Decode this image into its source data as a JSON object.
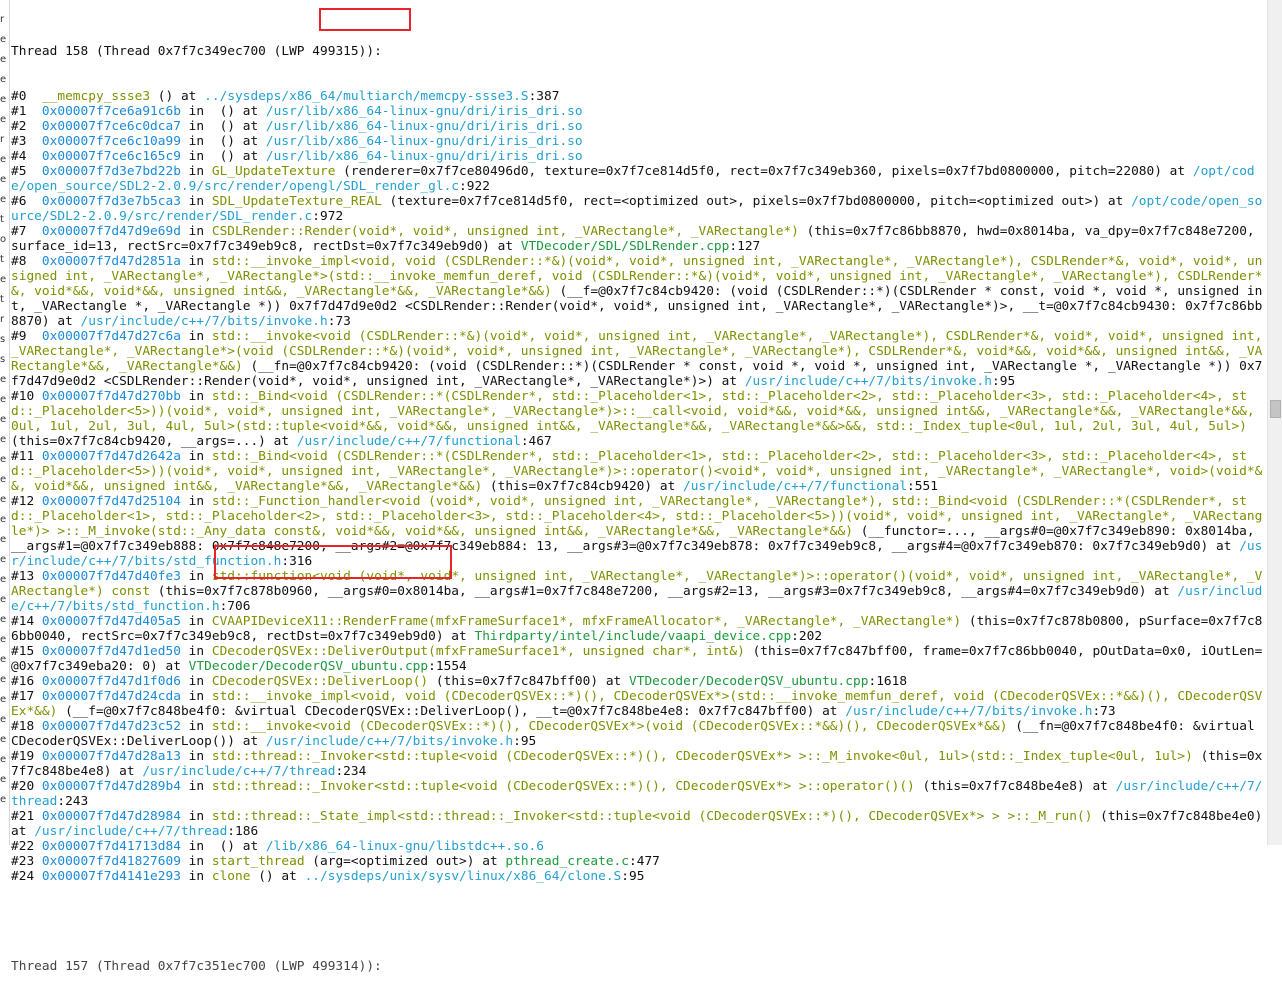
{
  "left_strip": [
    "r",
    "e",
    "e",
    "e",
    "e",
    "e",
    "r",
    "e",
    "e",
    "e",
    "t",
    "o",
    "t",
    "e",
    "t",
    "r",
    "s",
    "s",
    "e",
    "e",
    "e",
    "e",
    "e",
    "e",
    "e",
    "e",
    "e",
    "e",
    "e",
    "e",
    "e",
    "e",
    "e",
    "e",
    "e",
    "e",
    "e",
    "e",
    "e",
    "e"
  ],
  "header": {
    "prefix": "Thread 158 (Thread 0x7f7c349ec700 (LWP ",
    "lwp": "499315",
    "suffix": ")):"
  },
  "frames": [
    {
      "num": "#0  ",
      "segments": [
        {
          "t": "fn",
          "v": "__memcpy_ssse3"
        },
        {
          "t": "plain",
          "v": " () at "
        },
        {
          "t": "path",
          "v": "../sysdeps/x86_64/multiarch/memcpy-ssse3.S"
        },
        {
          "t": "plain",
          "v": ":387"
        }
      ]
    },
    {
      "num": "#1  ",
      "segments": [
        {
          "t": "addr",
          "v": "0x00007f7ce6a91c6b"
        },
        {
          "t": "plain",
          "v": " in  () at "
        },
        {
          "t": "path",
          "v": "/usr/lib/x86_64-linux-gnu/dri/iris_dri.so"
        }
      ]
    },
    {
      "num": "#2  ",
      "segments": [
        {
          "t": "addr",
          "v": "0x00007f7ce6c0dca7"
        },
        {
          "t": "plain",
          "v": " in  () at "
        },
        {
          "t": "path",
          "v": "/usr/lib/x86_64-linux-gnu/dri/iris_dri.so"
        }
      ]
    },
    {
      "num": "#3  ",
      "segments": [
        {
          "t": "addr",
          "v": "0x00007f7ce6c10a99"
        },
        {
          "t": "plain",
          "v": " in  () at "
        },
        {
          "t": "path",
          "v": "/usr/lib/x86_64-linux-gnu/dri/iris_dri.so"
        }
      ]
    },
    {
      "num": "#4  ",
      "segments": [
        {
          "t": "addr",
          "v": "0x00007f7ce6c165c9"
        },
        {
          "t": "plain",
          "v": " in  () at "
        },
        {
          "t": "path",
          "v": "/usr/lib/x86_64-linux-gnu/dri/iris_dri.so"
        }
      ]
    },
    {
      "num": "#5  ",
      "segments": [
        {
          "t": "addr",
          "v": "0x00007f7d3e7bd22b"
        },
        {
          "t": "plain",
          "v": " in "
        },
        {
          "t": "fn",
          "v": "GL_UpdateTexture"
        },
        {
          "t": "plain",
          "v": " (renderer=0x7f7ce80496d0, texture=0x7f7ce814d5f0, rect=0x7f7c349eb360, pixels=0x7f7bd0800000, pitch=22080) at "
        },
        {
          "t": "path",
          "v": "/opt/code/open_source/SDL2-2.0.9/src/render/opengl/SDL_render_gl.c"
        },
        {
          "t": "plain",
          "v": ":922"
        }
      ]
    },
    {
      "num": "#6  ",
      "segments": [
        {
          "t": "addr",
          "v": "0x00007f7d3e7b5ca3"
        },
        {
          "t": "plain",
          "v": " in "
        },
        {
          "t": "fn",
          "v": "SDL_UpdateTexture_REAL"
        },
        {
          "t": "plain",
          "v": " (texture=0x7f7ce814d5f0, rect=<optimized out>, pixels=0x7f7bd0800000, pitch=<optimized out>) at "
        },
        {
          "t": "path",
          "v": "/opt/code/open_source/SDL2-2.0.9/src/render/SDL_render.c"
        },
        {
          "t": "plain",
          "v": ":972"
        }
      ]
    },
    {
      "num": "#7  ",
      "segments": [
        {
          "t": "addr",
          "v": "0x00007f7d47d9e69d"
        },
        {
          "t": "plain",
          "v": " in "
        },
        {
          "t": "fn",
          "v": "CSDLRender::Render(void*, void*, unsigned int, _VARectangle*, _VARectangle*)"
        },
        {
          "t": "plain",
          "v": " (this=0x7f7c86bb8870, hwd=0x8014ba, va_dpy=0x7f7c848e7200, surface_id=13, rectSrc=0x7f7c349eb9c8, rectDst=0x7f7c349eb9d0) at "
        },
        {
          "t": "file",
          "v": "VTDecoder/SDL/SDLRender.cpp"
        },
        {
          "t": "plain",
          "v": ":127"
        }
      ]
    },
    {
      "num": "#8  ",
      "segments": [
        {
          "t": "addr",
          "v": "0x00007f7d47d2851a"
        },
        {
          "t": "plain",
          "v": " in "
        },
        {
          "t": "fn",
          "v": "std::__invoke_impl<void, void (CSDLRender::*&)(void*, void*, unsigned int, _VARectangle*, _VARectangle*), CSDLRender*&, void*, void*, unsigned int, _VARectangle*, _VARectangle*>(std::__invoke_memfun_deref, void (CSDLRender::*&)(void*, void*, unsigned int, _VARectangle*, _VARectangle*), CSDLRender*&, void*&&, void*&&, unsigned int&&, _VARectangle*&&, _VARectangle*&&)"
        },
        {
          "t": "plain",
          "v": " (__f=@0x7f7c84cb9420: (void (CSDLRender::*)(CSDLRender * const, void *, void *, unsigned int, _VARectangle *, _VARectangle *)) 0x7f7d47d9e0d2 <CSDLRender::Render(void*, void*, unsigned int, _VARectangle*, _VARectangle*)>, __t=@0x7f7c84cb9430: 0x7f7c86bb8870) at "
        },
        {
          "t": "path",
          "v": "/usr/include/c++/7/bits/invoke.h"
        },
        {
          "t": "plain",
          "v": ":73"
        }
      ]
    },
    {
      "num": "#9  ",
      "segments": [
        {
          "t": "addr",
          "v": "0x00007f7d47d27c6a"
        },
        {
          "t": "plain",
          "v": " in "
        },
        {
          "t": "fn",
          "v": "std::__invoke<void (CSDLRender::*&)(void*, void*, unsigned int, _VARectangle*, _VARectangle*), CSDLRender*&, void*, void*, unsigned int, _VARectangle*, _VARectangle*>(void (CSDLRender::*&)(void*, void*, unsigned int, _VARectangle*, _VARectangle*), CSDLRender*&, void*&&, void*&&, unsigned int&&, _VARectangle*&&, _VARectangle*&&)"
        },
        {
          "t": "plain",
          "v": " (__fn=@0x7f7c84cb9420: (void (CSDLRender::*)(CSDLRender * const, void *, void *, unsigned int, _VARectangle *, _VARectangle *)) 0x7f7d47d9e0d2 <CSDLRender::Render(void*, void*, unsigned int, _VARectangle*, _VARectangle*)>) at "
        },
        {
          "t": "path",
          "v": "/usr/include/c++/7/bits/invoke.h"
        },
        {
          "t": "plain",
          "v": ":95"
        }
      ]
    },
    {
      "num": "#10 ",
      "segments": [
        {
          "t": "addr",
          "v": "0x00007f7d47d270bb"
        },
        {
          "t": "plain",
          "v": " in "
        },
        {
          "t": "fn",
          "v": "std::_Bind<void (CSDLRender::*(CSDLRender*, std::_Placeholder<1>, std::_Placeholder<2>, std::_Placeholder<3>, std::_Placeholder<4>, std::_Placeholder<5>))(void*, void*, unsigned int, _VARectangle*, _VARectangle*)>::__call<void, void*&&, void*&&, unsigned int&&, _VARectangle*&&, _VARectangle*&&, 0ul, 1ul, 2ul, 3ul, 4ul, 5ul>(std::tuple<void*&&, void*&&, unsigned int&&, _VARectangle*&&, _VARectangle*&&>&&, std::_Index_tuple<0ul, 1ul, 2ul, 3ul, 4ul, 5ul>)"
        },
        {
          "t": "plain",
          "v": " (this=0x7f7c84cb9420, __args=...) at "
        },
        {
          "t": "path",
          "v": "/usr/include/c++/7/functional"
        },
        {
          "t": "plain",
          "v": ":467"
        }
      ]
    },
    {
      "num": "#11 ",
      "segments": [
        {
          "t": "addr",
          "v": "0x00007f7d47d2642a"
        },
        {
          "t": "plain",
          "v": " in "
        },
        {
          "t": "fn",
          "v": "std::_Bind<void (CSDLRender::*(CSDLRender*, std::_Placeholder<1>, std::_Placeholder<2>, std::_Placeholder<3>, std::_Placeholder<4>, std::_Placeholder<5>))(void*, void*, unsigned int, _VARectangle*, _VARectangle*)>::operator()<void*, void*, unsigned int, _VARectangle*, _VARectangle*, void>(void*&&, void*&&, unsigned int&&, _VARectangle*&&, _VARectangle*&&)"
        },
        {
          "t": "plain",
          "v": " (this=0x7f7c84cb9420) at "
        },
        {
          "t": "path",
          "v": "/usr/include/c++/7/functional"
        },
        {
          "t": "plain",
          "v": ":551"
        }
      ]
    },
    {
      "num": "#12 ",
      "segments": [
        {
          "t": "addr",
          "v": "0x00007f7d47d25104"
        },
        {
          "t": "plain",
          "v": " in "
        },
        {
          "t": "fn",
          "v": "std::_Function_handler<void (void*, void*, unsigned int, _VARectangle*, _VARectangle*), std::_Bind<void (CSDLRender::*(CSDLRender*, std::_Placeholder<1>, std::_Placeholder<2>, std::_Placeholder<3>, std::_Placeholder<4>, std::_Placeholder<5>))(void*, void*, unsigned int, _VARectangle*, _VARectangle*)> >::_M_invoke(std::_Any_data const&, void*&&, void*&&, unsigned int&&, _VARectangle*&&, _VARectangle*&&)"
        },
        {
          "t": "plain",
          "v": " (__functor=..., __args#0=@0x7f7c349eb890: 0x8014ba, __args#1=@0x7f7c349eb888: 0x7f7c848e7200, __args#2=@0x7f7c349eb884: 13, __args#3=@0x7f7c349eb878: 0x7f7c349eb9c8, __args#4=@0x7f7c349eb870: 0x7f7c349eb9d0) at "
        },
        {
          "t": "path",
          "v": "/usr/include/c++/7/bits/std_function.h"
        },
        {
          "t": "plain",
          "v": ":316"
        }
      ]
    },
    {
      "num": "#13 ",
      "segments": [
        {
          "t": "addr",
          "v": "0x00007f7d47d40fe3"
        },
        {
          "t": "plain",
          "v": " in "
        },
        {
          "t": "fn",
          "v": "std::function<void (void*, void*, unsigned int, _VARectangle*, _VARectangle*)>::operator()(void*, void*, unsigned int, _VARectangle*, _VARectangle*) const"
        },
        {
          "t": "plain",
          "v": " (this=0x7f7c878b0960, __args#0=0x8014ba, __args#1=0x7f7c848e7200, __args#2=13, __args#3=0x7f7c349eb9c8, __args#4=0x7f7c349eb9d0) at "
        },
        {
          "t": "path",
          "v": "/usr/include/c++/7/bits/std_function.h"
        },
        {
          "t": "plain",
          "v": ":706"
        }
      ]
    },
    {
      "num": "#14 ",
      "segments": [
        {
          "t": "addr",
          "v": "0x00007f7d47d405a5"
        },
        {
          "t": "plain",
          "v": " in "
        },
        {
          "t": "fn",
          "v": "CVAAPIDeviceX11::RenderFrame(mfxFrameSurface1*, mfxFrameAllocator*, _VARectangle*, _VARectangle*)"
        },
        {
          "t": "plain",
          "v": " (this=0x7f7c878b0800, pSurface=0x7f7c86bb0040, rectSrc=0x7f7c349eb9c8, rectDst=0x7f7c349eb9d0) at "
        },
        {
          "t": "file",
          "v": "Thirdparty/intel/include/vaapi_device.cpp"
        },
        {
          "t": "plain",
          "v": ":202"
        }
      ]
    },
    {
      "num": "#15 ",
      "segments": [
        {
          "t": "addr",
          "v": "0x00007f7d47d1ed50"
        },
        {
          "t": "plain",
          "v": " in "
        },
        {
          "t": "fn",
          "v": "CDecoderQSVEx::DeliverOutput(mfxFrameSurface1*, unsigned char*, int&)"
        },
        {
          "t": "plain",
          "v": " (this=0x7f7c847bff00, frame=0x7f7c86bb0040, pOutData=0x0, iOutLen=@0x7f7c349eba20: 0) at "
        },
        {
          "t": "file",
          "v": "VTDecoder/DecoderQSV_ubuntu.cpp"
        },
        {
          "t": "plain",
          "v": ":1554"
        }
      ]
    },
    {
      "num": "#16 ",
      "segments": [
        {
          "t": "addr",
          "v": "0x00007f7d47d1f0d6"
        },
        {
          "t": "plain",
          "v": " in "
        },
        {
          "t": "fn",
          "v": "CDecoderQSVEx::DeliverLoop()"
        },
        {
          "t": "plain",
          "v": " (this=0x7f7c847bff00) at "
        },
        {
          "t": "file",
          "v": "VTDecoder/DecoderQSV_ubuntu.cpp"
        },
        {
          "t": "plain",
          "v": ":1618"
        }
      ]
    },
    {
      "num": "#17 ",
      "segments": [
        {
          "t": "addr",
          "v": "0x00007f7d47d24cda"
        },
        {
          "t": "plain",
          "v": " in "
        },
        {
          "t": "fn",
          "v": "std::__invoke_impl<void, void (CDecoderQSVEx::*)(), CDecoderQSVEx*>(std::__invoke_memfun_deref, void (CDecoderQSVEx::*&&)(), CDecoderQSVEx*&&)"
        },
        {
          "t": "plain",
          "v": " (__f=@0x7f7c848be4f0: &virtual CDecoderQSVEx::DeliverLoop(), __t=@0x7f7c848be4e8: 0x7f7c847bff00) at "
        },
        {
          "t": "path",
          "v": "/usr/include/c++/7/bits/invoke.h"
        },
        {
          "t": "plain",
          "v": ":73"
        }
      ]
    },
    {
      "num": "#18 ",
      "segments": [
        {
          "t": "addr",
          "v": "0x00007f7d47d23c52"
        },
        {
          "t": "plain",
          "v": " in "
        },
        {
          "t": "fn",
          "v": "std::__invoke<void (CDecoderQSVEx::*)(), CDecoderQSVEx*>(void (CDecoderQSVEx::*&&)(), CDecoderQSVEx*&&)"
        },
        {
          "t": "plain",
          "v": " (__fn=@0x7f7c848be4f0: &virtual CDecoderQSVEx::DeliverLoop()) at "
        },
        {
          "t": "path",
          "v": "/usr/include/c++/7/bits/invoke.h"
        },
        {
          "t": "plain",
          "v": ":95"
        }
      ]
    },
    {
      "num": "#19 ",
      "segments": [
        {
          "t": "addr",
          "v": "0x00007f7d47d28a13"
        },
        {
          "t": "plain",
          "v": " in "
        },
        {
          "t": "fn",
          "v": "std::thread::_Invoker<std::tuple<void (CDecoderQSVEx::*)(), CDecoderQSVEx*> >::_M_invoke<0ul, 1ul>(std::_Index_tuple<0ul, 1ul>)"
        },
        {
          "t": "plain",
          "v": " (this=0x7f7c848be4e8) at "
        },
        {
          "t": "path",
          "v": "/usr/include/c++/7/thread"
        },
        {
          "t": "plain",
          "v": ":234"
        }
      ]
    },
    {
      "num": "#20 ",
      "segments": [
        {
          "t": "addr",
          "v": "0x00007f7d47d289b4"
        },
        {
          "t": "plain",
          "v": " in "
        },
        {
          "t": "fn",
          "v": "std::thread::_Invoker<std::tuple<void (CDecoderQSVEx::*)(), CDecoderQSVEx*> >::operator()()"
        },
        {
          "t": "plain",
          "v": " (this=0x7f7c848be4e8) at "
        },
        {
          "t": "path",
          "v": "/usr/include/c++/7/thread"
        },
        {
          "t": "plain",
          "v": ":243"
        }
      ]
    },
    {
      "num": "#21 ",
      "segments": [
        {
          "t": "addr",
          "v": "0x00007f7d47d28984"
        },
        {
          "t": "plain",
          "v": " in "
        },
        {
          "t": "fn",
          "v": "std::thread::_State_impl<std::thread::_Invoker<std::tuple<void (CDecoderQSVEx::*)(), CDecoderQSVEx*> > >::_M_run()"
        },
        {
          "t": "plain",
          "v": " (this=0x7f7c848be4e0) at "
        },
        {
          "t": "path",
          "v": "/usr/include/c++/7/thread"
        },
        {
          "t": "plain",
          "v": ":186"
        }
      ]
    },
    {
      "num": "#22 ",
      "segments": [
        {
          "t": "addr",
          "v": "0x00007f7d41713d84"
        },
        {
          "t": "plain",
          "v": " in  () at "
        },
        {
          "t": "path",
          "v": "/lib/x86_64-linux-gnu/libstdc++.so.6"
        }
      ]
    },
    {
      "num": "#23 ",
      "segments": [
        {
          "t": "addr",
          "v": "0x00007f7d41827609"
        },
        {
          "t": "plain",
          "v": " in "
        },
        {
          "t": "fn",
          "v": "start_thread"
        },
        {
          "t": "plain",
          "v": " (arg=<optimized out>) at "
        },
        {
          "t": "file",
          "v": "pthread_create.c"
        },
        {
          "t": "plain",
          "v": ":477"
        }
      ]
    },
    {
      "num": "#24 ",
      "segments": [
        {
          "t": "addr",
          "v": "0x00007f7d4141e293"
        },
        {
          "t": "plain",
          "v": " in "
        },
        {
          "t": "fn",
          "v": "clone"
        },
        {
          "t": "plain",
          "v": " () at "
        },
        {
          "t": "path",
          "v": "../sysdeps/unix/sysv/linux/x86_64/clone.S"
        },
        {
          "t": "plain",
          "v": ":95"
        }
      ]
    }
  ],
  "trailing": "Thread 157 (Thread 0x7f7c351ec700 (LWP 499314)):",
  "colors": {
    "address": "#1a8bd6",
    "function": "#7e9000",
    "path": "#23a0cf",
    "file": "#1c9a3e",
    "highlight": "#e8232a"
  }
}
